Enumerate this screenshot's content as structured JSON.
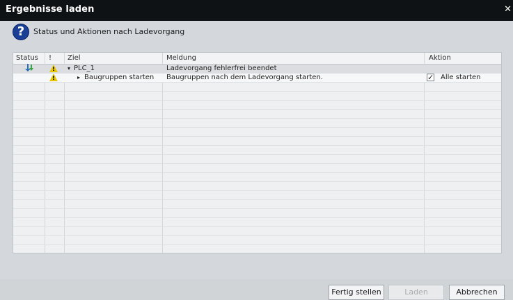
{
  "dialog": {
    "title": "Ergebnisse laden",
    "close_glyph": "✕",
    "subtitle": "Status und Aktionen nach Ladevorgang"
  },
  "grid": {
    "headers": {
      "status": "Status",
      "warn": "!",
      "target": "Ziel",
      "message": "Meldung",
      "action": "Aktion"
    },
    "rows": [
      {
        "status_icon": "download-arrow-icon",
        "warn_icon": "warning-icon",
        "expand_glyph": "▾",
        "target": "PLC_1",
        "message": "Ladevorgang fehlerfrei beendet",
        "action": ""
      },
      {
        "status_icon": "",
        "warn_icon": "warning-icon",
        "expand_glyph": "▸",
        "target": "Baugruppen starten",
        "message": "Baugruppen nach dem Ladevorgang starten.",
        "action": "Alle starten",
        "checked": true
      }
    ]
  },
  "buttons": {
    "finish": "Fertig stellen",
    "load": "Laden",
    "cancel": "Abbrechen"
  },
  "colors": {
    "titlebar": "#0f1214",
    "warning": "#e7c600",
    "help": "#1c3f96"
  }
}
